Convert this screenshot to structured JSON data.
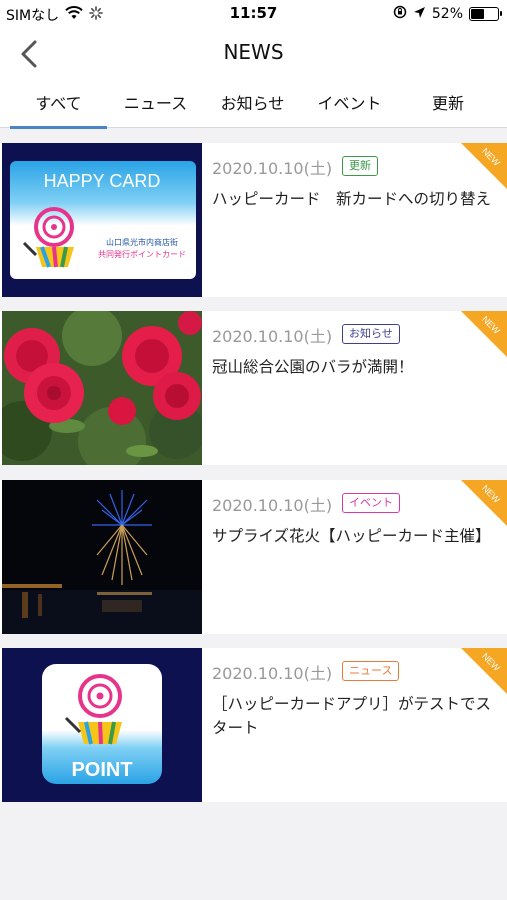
{
  "status_bar": {
    "carrier": "SIMなし",
    "time": "11:57",
    "battery": "52%",
    "battery_level": 0.52,
    "icons": [
      "wifi-icon",
      "loading-icon",
      "lock-rotation-icon",
      "location-arrow-icon",
      "battery-icon"
    ]
  },
  "nav": {
    "title": "NEWS",
    "back_icon": "chevron-left-icon"
  },
  "tabs": [
    {
      "label": "すべて",
      "active": true
    },
    {
      "label": "ニュース"
    },
    {
      "label": "お知らせ"
    },
    {
      "label": "イベント"
    },
    {
      "label": "更新"
    }
  ],
  "news": [
    {
      "date": "2020.10.10(土)",
      "category": "更新",
      "category_color": "#3a9a4a",
      "title": "ハッピーカード　新カードへの切り替え",
      "new": "NEW",
      "image": "happy-card"
    },
    {
      "date": "2020.10.10(土)",
      "category": "お知らせ",
      "category_color": "#3f3f8f",
      "title": "冠山総合公園のバラが満開！",
      "new": "NEW",
      "image": "roses"
    },
    {
      "date": "2020.10.10(土)",
      "category": "イベント",
      "category_color": "#d63aa8",
      "title": "サプライズ花火【ハッピーカード主催】",
      "new": "NEW",
      "image": "fireworks"
    },
    {
      "date": "2020.10.10(土)",
      "category": "ニュース",
      "category_color": "#e87a3a",
      "title": "［ハッピーカードアプリ］がテストでスタート",
      "new": "NEW",
      "image": "point-app"
    }
  ],
  "images": {
    "happy_card": {
      "label": "HAPPY CARD",
      "caption_1": "山口県光市内商店街",
      "caption_2": "共同発行ポイントカード"
    },
    "point_app": {
      "label": "POINT"
    }
  },
  "colors": {
    "accent": "#4a86c5",
    "new_ribbon": "#f5a623",
    "card_navy": "#0d1150"
  }
}
